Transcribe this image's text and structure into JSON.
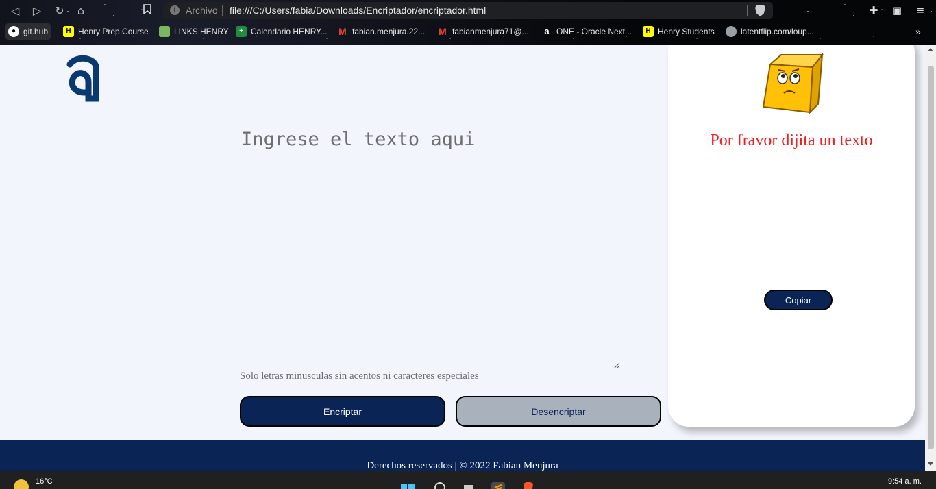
{
  "browser": {
    "url_scheme_label": "Archivo",
    "url": "file:///C:/Users/fabia/Downloads/Encriptador/encriptador.html",
    "bookmarks": [
      {
        "label": "git.hub",
        "icon": "github-icon"
      },
      {
        "label": "Henry Prep Course",
        "icon": "henry-icon"
      },
      {
        "label": "LINKS HENRY",
        "icon": "notebook-icon"
      },
      {
        "label": "Calendario HENRY...",
        "icon": "sheets-icon"
      },
      {
        "label": "fabian.menjura.22...",
        "icon": "gmail-icon"
      },
      {
        "label": "fabianmenjura71@...",
        "icon": "gmail-icon"
      },
      {
        "label": "ONE - Oracle Next...",
        "icon": "alura-icon"
      },
      {
        "label": "Henry Students",
        "icon": "henry-icon"
      },
      {
        "label": "latentflip.com/loup...",
        "icon": "globe-icon"
      }
    ],
    "more_bookmarks": "»"
  },
  "app": {
    "input_placeholder": "Ingrese el texto aqui",
    "hint": "Solo letras minusculas sin acentos ni caracteres especiales",
    "encrypt_label": "Encriptar",
    "decrypt_label": "Desencriptar",
    "result_message": "Por fravor dijita un texto",
    "copy_label": "Copiar",
    "footer": "Derechos reservados | © 2022 Fabian Menjura"
  },
  "colors": {
    "primary": "#0a2456",
    "secondary": "#a9b1bd",
    "message": "#f41c1c",
    "page_bg": "#f3f5fc"
  },
  "taskbar": {
    "temperature": "16°C",
    "time": "9:54 a. m."
  }
}
